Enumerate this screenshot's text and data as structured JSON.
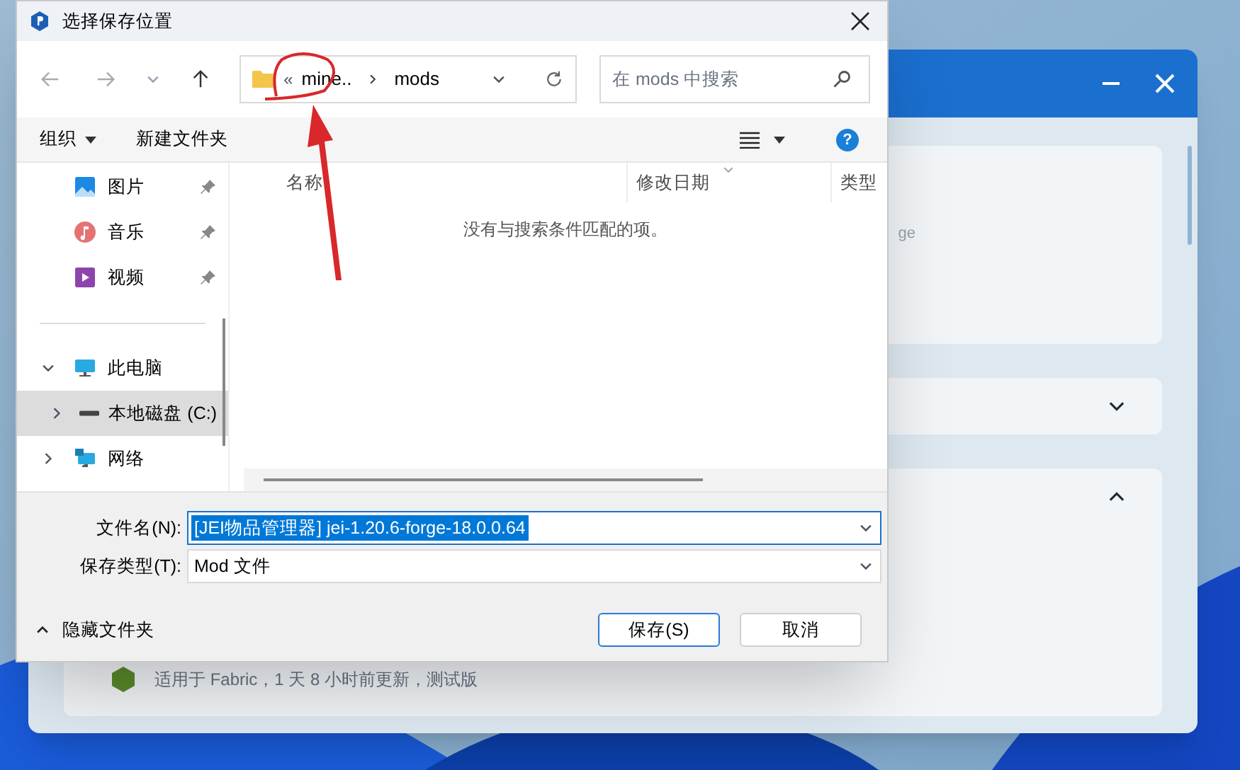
{
  "background_window": {
    "cards": [
      {
        "text": "ge"
      },
      {
        "expanded": false
      },
      {
        "expanded": true,
        "text": "适用于 Fabric，1 天 8 小时前更新，测试版"
      }
    ]
  },
  "dialog": {
    "title": "选择保存位置",
    "address": {
      "overflow": "«",
      "segments": [
        "mine..",
        "mods"
      ]
    },
    "search": {
      "placeholder": "在 mods 中搜索"
    },
    "toolbar": {
      "organize": "组织",
      "new_folder": "新建文件夹",
      "help": "?"
    },
    "sidebar": {
      "items": [
        {
          "label": "图片",
          "kind": "pictures",
          "pinned": true,
          "selected": false
        },
        {
          "label": "音乐",
          "kind": "music",
          "pinned": true,
          "selected": false
        },
        {
          "label": "视频",
          "kind": "videos",
          "pinned": true,
          "selected": false
        },
        {
          "label": "此电脑",
          "kind": "pc",
          "expanded": true,
          "selected": false,
          "children": [
            {
              "label": "本地磁盘 (C:)",
              "kind": "drive",
              "expanded": false,
              "selected": true
            }
          ]
        },
        {
          "label": "网络",
          "kind": "network",
          "expanded": false,
          "selected": false
        }
      ]
    },
    "file_list": {
      "columns": [
        "名称",
        "修改日期",
        "类型"
      ],
      "empty_message": "没有与搜索条件匹配的项。"
    },
    "file_name": {
      "label": "文件名(N):",
      "value": "[JEI物品管理器] jei-1.20.6-forge-18.0.0.64",
      "selected": true
    },
    "file_type": {
      "label": "保存类型(T):",
      "value": "Mod 文件"
    },
    "hide_folders": "隐藏文件夹",
    "buttons": [
      {
        "label": "保存(S)",
        "default": true
      },
      {
        "label": "取消",
        "default": false
      }
    ]
  }
}
